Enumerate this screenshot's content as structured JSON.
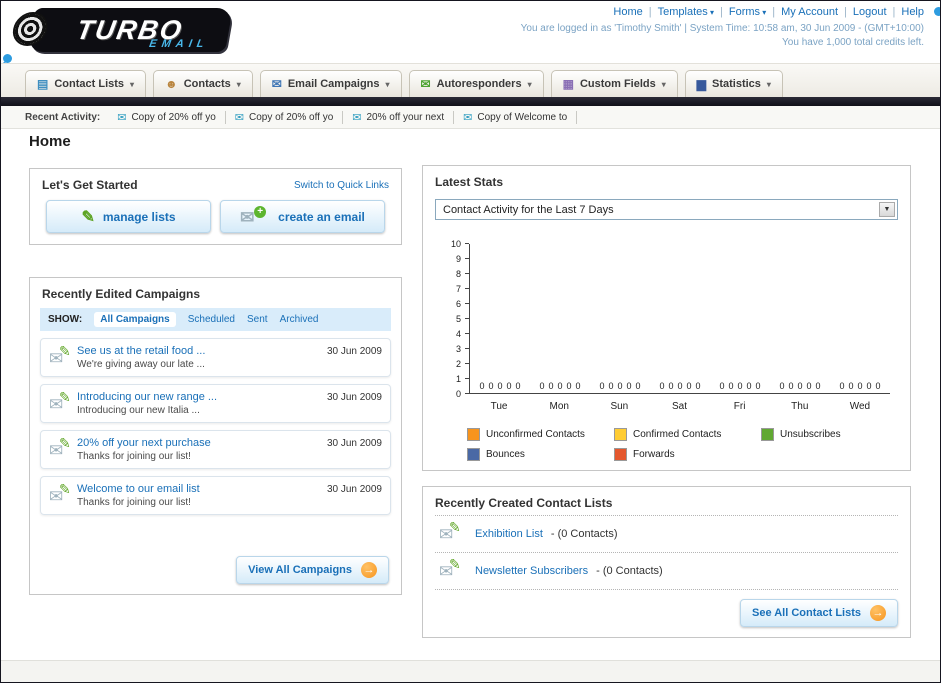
{
  "header": {
    "logo": {
      "title": "TURBO",
      "subtitle": "EMAIL"
    },
    "nav_links": [
      {
        "label": "Home",
        "dropdown": false
      },
      {
        "label": "Templates",
        "dropdown": true
      },
      {
        "label": "Forms",
        "dropdown": true
      },
      {
        "label": "My Account",
        "dropdown": false
      },
      {
        "label": "Logout",
        "dropdown": false
      },
      {
        "label": "Help",
        "dropdown": false
      }
    ],
    "login_info": "You are logged in as 'Timothy Smith' | System Time: 10:58 am, 30 Jun 2009 - (GMT+10:00)",
    "credits_info": "You have 1,000 total credits left."
  },
  "main_nav": {
    "tabs": [
      {
        "label": "Contact Lists",
        "icon": "contact-lists-icon"
      },
      {
        "label": "Contacts",
        "icon": "contacts-icon"
      },
      {
        "label": "Email Campaigns",
        "icon": "email-campaigns-icon"
      },
      {
        "label": "Autoresponders",
        "icon": "autoresponders-icon"
      },
      {
        "label": "Custom Fields",
        "icon": "custom-fields-icon"
      },
      {
        "label": "Statistics",
        "icon": "statistics-icon"
      }
    ]
  },
  "recent_activity": {
    "label": "Recent Activity:",
    "items": [
      "Copy of 20% off yo",
      "Copy of 20% off yo",
      "20% off your next",
      "Copy of Welcome to"
    ]
  },
  "page_title": "Home",
  "get_started": {
    "title": "Let's Get Started",
    "switch_link": "Switch to Quick Links",
    "manage_lists_label": "manage lists",
    "create_email_label": "create an email"
  },
  "campaigns": {
    "title": "Recently Edited Campaigns",
    "show_label": "SHOW:",
    "filters": [
      "All Campaigns",
      "Scheduled",
      "Sent",
      "Archived"
    ],
    "selected_filter": "All Campaigns",
    "items": [
      {
        "title": "See us at the retail food ...",
        "subtitle": "We're giving away our late ...",
        "date": "30 Jun 2009"
      },
      {
        "title": "Introducing our new range ...",
        "subtitle": "Introducing our new Italia ...",
        "date": "30 Jun 2009"
      },
      {
        "title": "20% off your next purchase",
        "subtitle": "Thanks for joining our list!",
        "date": "30 Jun 2009"
      },
      {
        "title": "Welcome to our email list",
        "subtitle": "Thanks for joining our list!",
        "date": "30 Jun 2009"
      }
    ],
    "view_all_label": "View All Campaigns"
  },
  "stats": {
    "title": "Latest Stats",
    "dropdown_value": "Contact Activity for the Last 7 Days",
    "chart_data": {
      "type": "bar",
      "title": "Contact Activity for the Last 7 Days",
      "categories": [
        "Tue",
        "Mon",
        "Sun",
        "Sat",
        "Fri",
        "Thu",
        "Wed"
      ],
      "series": [
        {
          "name": "Unconfirmed Contacts",
          "color": "#f7941d",
          "values": [
            0,
            0,
            0,
            0,
            0,
            0,
            0
          ]
        },
        {
          "name": "Confirmed Contacts",
          "color": "#ffcc33",
          "values": [
            0,
            0,
            0,
            0,
            0,
            0,
            0
          ]
        },
        {
          "name": "Unsubscribes",
          "color": "#61a832",
          "values": [
            0,
            0,
            0,
            0,
            0,
            0,
            0
          ]
        },
        {
          "name": "Bounces",
          "color": "#4a69a5",
          "values": [
            0,
            0,
            0,
            0,
            0,
            0,
            0
          ]
        },
        {
          "name": "Forwards",
          "color": "#e4572e",
          "values": [
            0,
            0,
            0,
            0,
            0,
            0,
            0
          ]
        }
      ],
      "ylim": [
        0,
        10
      ],
      "ytick_step": 1,
      "grid": false,
      "legend_position": "bottom",
      "value_labels_shown": true
    }
  },
  "contact_lists": {
    "title": "Recently Created Contact Lists",
    "items": [
      {
        "name": "Exhibition List",
        "suffix": "- (0 Contacts)"
      },
      {
        "name": "Newsletter Subscribers",
        "suffix": "- (0 Contacts)"
      }
    ],
    "see_all_label": "See All Contact Lists"
  }
}
